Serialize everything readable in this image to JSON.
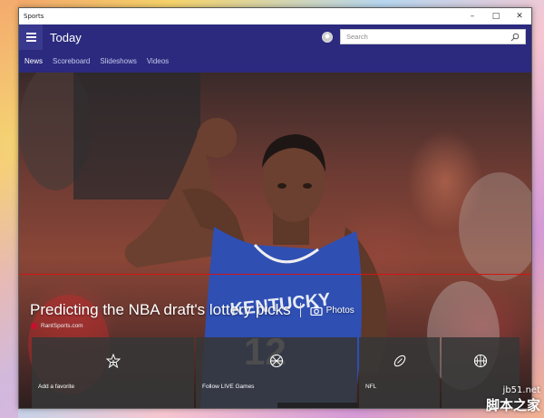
{
  "window": {
    "title": "Sports"
  },
  "appbar": {
    "title": "Today",
    "search_placeholder": "Search"
  },
  "nav": {
    "tabs": [
      "News",
      "Scoreboard",
      "Slideshows",
      "Videos"
    ],
    "active": "News"
  },
  "hero": {
    "headline": "Predicting the NBA draft's lottery picks",
    "photos_label": "Photos",
    "source": "RantSports.com",
    "jersey_text": "KENTUCKY",
    "jersey_number": "12"
  },
  "tiles": [
    {
      "label": "Add a favorite",
      "icon": "star-add-icon"
    },
    {
      "label": "Follow LIVE Games",
      "icon": "basketball-icon"
    },
    {
      "label": "NFL",
      "icon": "football-icon"
    },
    {
      "label": "",
      "icon": "basketball-icon"
    }
  ],
  "watermark": {
    "line1": "jb51.net",
    "line2": "脚本之家"
  },
  "colors": {
    "accent": "#2b2a7e",
    "headline_line": "#d21414"
  }
}
